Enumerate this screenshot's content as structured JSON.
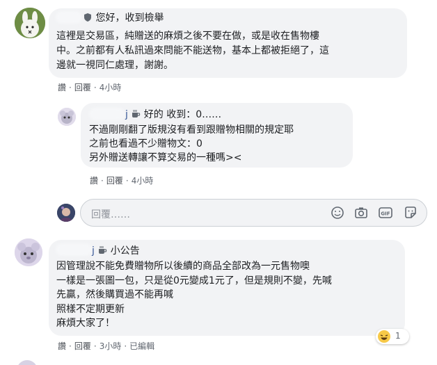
{
  "comment1": {
    "badge_icon": "shield-badge-icon",
    "text_lines": [
      "您好，收到檢舉",
      "這裡是交易區，純贈送的麻煩之後不要在做，或是收在售物樓",
      "中。之前都有人私訊過來問能不能送物，基本上都被拒絕了，這",
      "邊就一視同仁處理，謝謝。"
    ],
    "like": "讚",
    "reply": "回覆",
    "time": "4小時"
  },
  "reply1": {
    "name_suffix": "j",
    "text_lines": [
      "好的 收到：0……",
      "不過剛剛翻了版規沒有看到跟贈物相關的規定耶",
      "之前也看過不少贈物文：0",
      "另外贈送轉讓不算交易的一種嗎><"
    ],
    "like": "讚",
    "reply": "回覆",
    "time": "4小時"
  },
  "reply_input": {
    "placeholder": "回覆……",
    "icons": [
      "emoji-icon",
      "camera-icon",
      "gif-icon",
      "sticker-icon"
    ]
  },
  "comment2": {
    "name_suffix": "j",
    "text_lines": [
      "小公告",
      "因管理說不能免費贈物所以後續的商品全部改為一元售物噢",
      "一樣是一張圖一包，只是從0元變成1元了，但是規則不變，先喊",
      "先贏，然後購買過不能再喊",
      "照樣不定期更新",
      "麻煩大家了！"
    ],
    "like": "讚",
    "reply": "回覆",
    "time": "3小時",
    "edited": "已編輯",
    "reaction_count": "1"
  },
  "colors": {
    "bubble": "#f2f3f5",
    "text": "#1c1e21",
    "meta": "#616770",
    "link": "#385898"
  }
}
